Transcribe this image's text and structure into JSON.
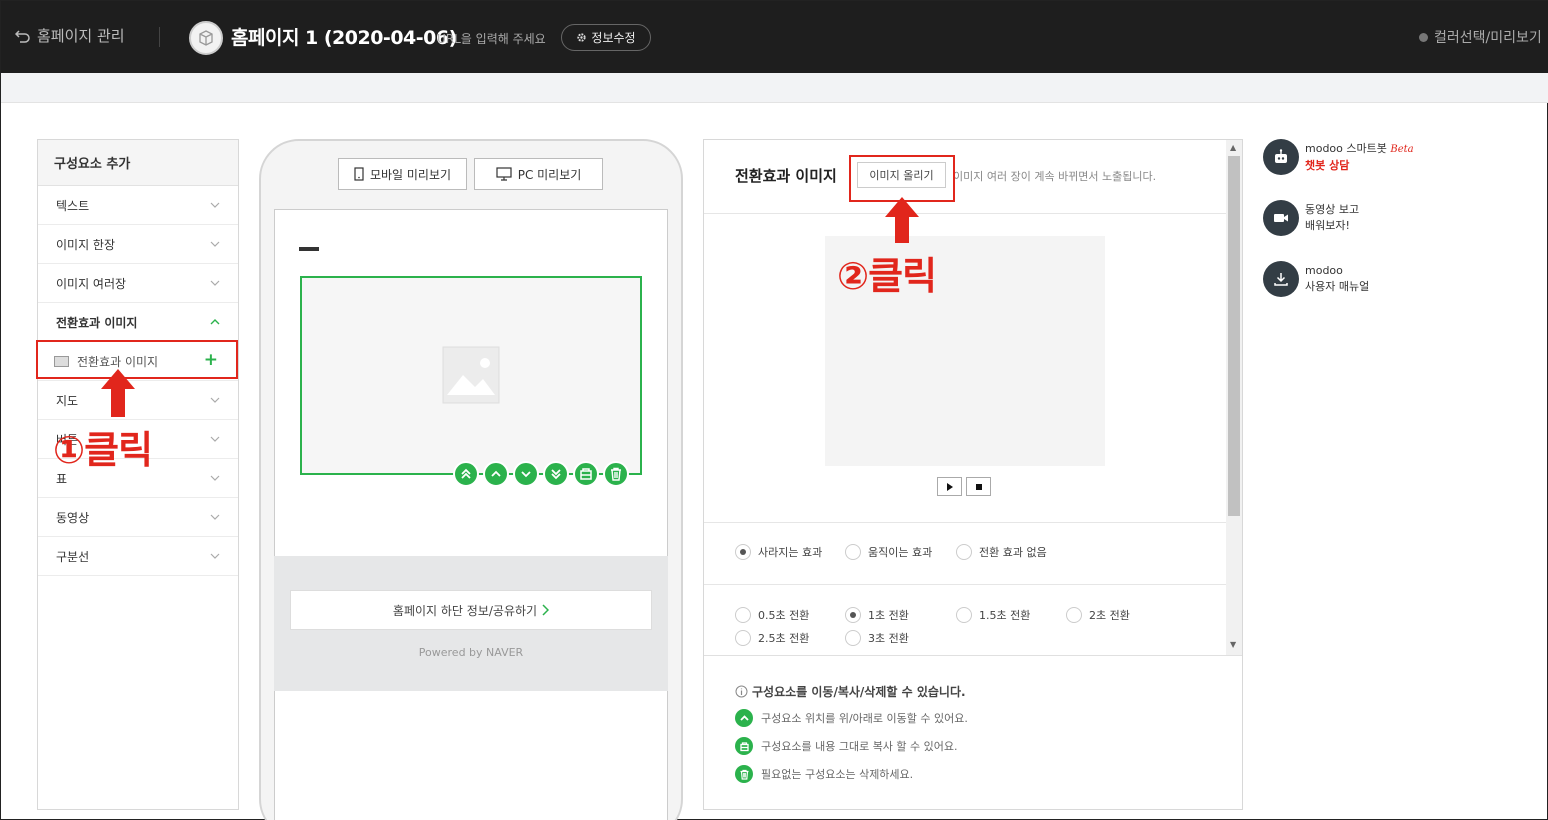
{
  "topbar": {
    "back_label": "홈페이지 관리",
    "site_title": "홈페이지 1 (2020-04-06)",
    "url_hint": "URL을 입력해 주세요",
    "info_edit_label": "정보수정",
    "color_select_label": "컬러선택/미리보기"
  },
  "left_panel": {
    "title": "구성요소 추가",
    "items": [
      {
        "label": "텍스트"
      },
      {
        "label": "이미지 한장"
      },
      {
        "label": "이미지 여러장"
      },
      {
        "label": "전환효과 이미지"
      },
      {
        "label": "지도"
      },
      {
        "label": "버튼"
      },
      {
        "label": "표"
      },
      {
        "label": "동영상"
      },
      {
        "label": "구분선"
      }
    ],
    "sub_item_label": "전환효과 이미지",
    "sub_item_add": "+"
  },
  "phone": {
    "mobile_preview_label": "모바일 미리보기",
    "pc_preview_label": "PC 미리보기",
    "footer_link_label": "홈페이지 하단 정보/공유하기",
    "powered_by": "Powered by NAVER"
  },
  "editor": {
    "title": "전환효과 이미지",
    "upload_label": "이미지 올리기",
    "description": "이미지 여러 장이 계속 바뀌면서 노출됩니다.",
    "effects": [
      {
        "label": "사라지는 효과",
        "selected": true
      },
      {
        "label": "움직이는 효과",
        "selected": false
      },
      {
        "label": "전환 효과 없음",
        "selected": false
      }
    ],
    "intervals": [
      {
        "label": "0.5초 전환",
        "selected": false
      },
      {
        "label": "1초 전환",
        "selected": true
      },
      {
        "label": "1.5초 전환",
        "selected": false
      },
      {
        "label": "2초 전환",
        "selected": false
      },
      {
        "label": "2.5초 전환",
        "selected": false
      },
      {
        "label": "3초 전환",
        "selected": false
      }
    ],
    "help_title": "구성요소를 이동/복사/삭제할 수 있습니다.",
    "help_move": "구성요소 위치를 위/아래로 이동할 수 있어요.",
    "help_copy": "구성요소를 내용 그대로 복사 할 수 있어요.",
    "help_delete": "필요없는 구성요소는 삭제하세요."
  },
  "side_menu": {
    "chatbot_line1": "modoo 스마트봇",
    "chatbot_beta": "Beta",
    "chatbot_line2": "챗봇 상담",
    "video_line1": "동영상 보고",
    "video_line2": "배워보자!",
    "manual_line1": "modoo",
    "manual_line2": "사용자 매뉴얼"
  },
  "annotations": {
    "step1": "①클릭",
    "step2": "②클릭"
  },
  "colors": {
    "accent_green": "#2bb24c",
    "annotation_red": "#e1261c",
    "topbar_bg": "#1e1e1e"
  }
}
